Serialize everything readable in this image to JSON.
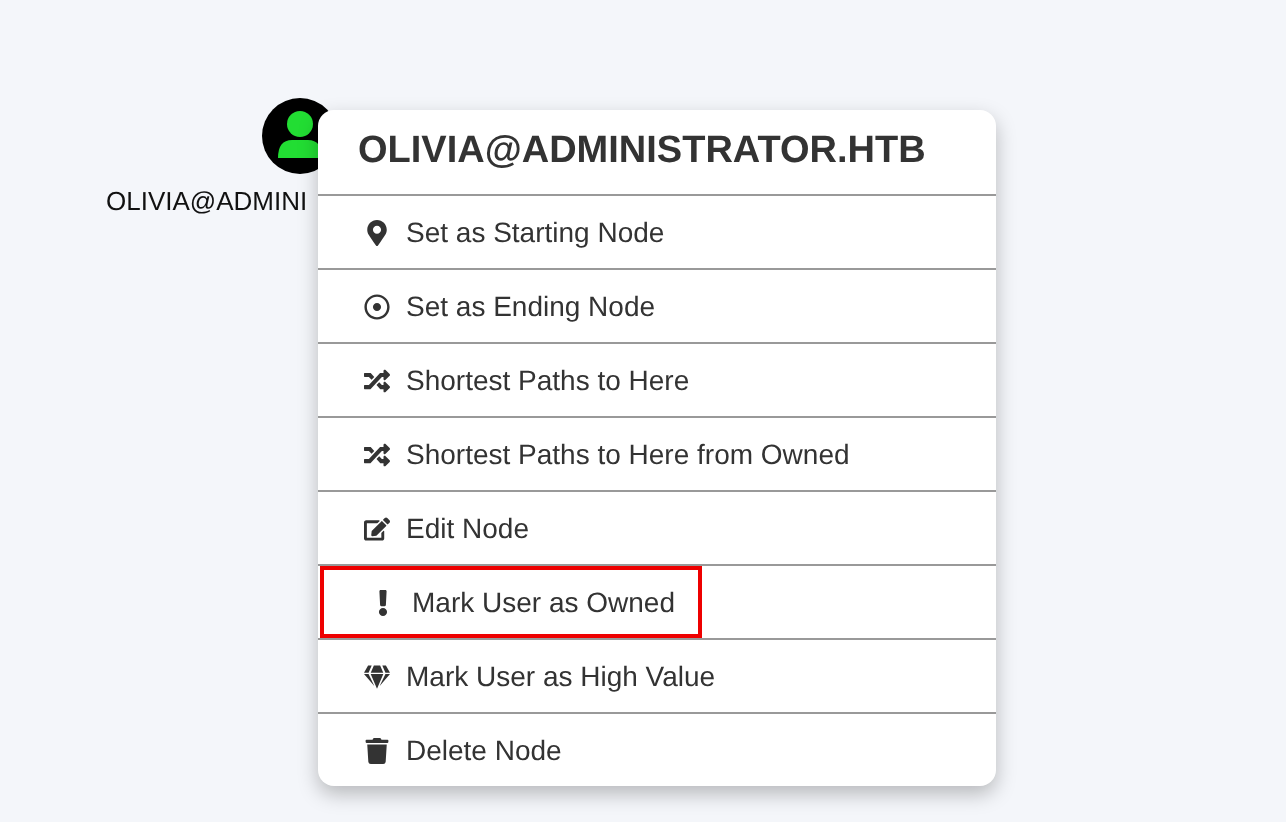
{
  "node": {
    "label": "OLIVIA@ADMINI"
  },
  "context_menu": {
    "title": "OLIVIA@ADMINISTRATOR.HTB",
    "items": [
      {
        "label": "Set as Starting Node",
        "highlighted": false
      },
      {
        "label": "Set as Ending Node",
        "highlighted": false
      },
      {
        "label": "Shortest Paths to Here",
        "highlighted": false
      },
      {
        "label": "Shortest Paths to Here from Owned",
        "highlighted": false
      },
      {
        "label": "Edit Node",
        "highlighted": false
      },
      {
        "label": "Mark User as Owned",
        "highlighted": true
      },
      {
        "label": "Mark User as High Value",
        "highlighted": false
      },
      {
        "label": "Delete Node",
        "highlighted": false
      }
    ]
  }
}
